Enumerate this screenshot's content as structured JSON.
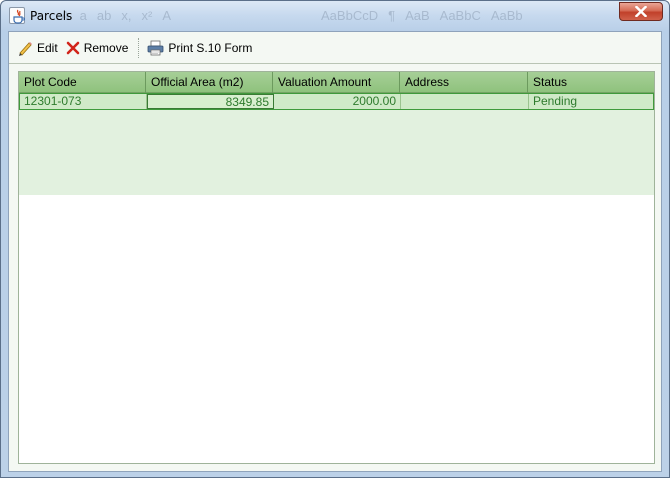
{
  "window": {
    "title": "Parcels",
    "ghost_items": [
      "A",
      "a",
      "ab",
      "x,",
      "x²",
      "A",
      "AaBbCcD",
      "¶",
      "AaB",
      "AaBbC",
      "AaBb"
    ]
  },
  "toolbar": {
    "edit_label": "Edit",
    "remove_label": "Remove",
    "print_label": "Print S.10 Form"
  },
  "table": {
    "columns": [
      "Plot Code",
      "Official Area (m2)",
      "Valuation Amount",
      "Address",
      "Status"
    ],
    "rows": [
      {
        "plot_code": "12301-073",
        "official_area": "8349.85",
        "valuation_amount": "2000.00",
        "address": "",
        "status": "Pending"
      }
    ]
  },
  "colors": {
    "header_green": "#8fc27d",
    "row_selected": "#d0eac8",
    "cell_text": "#2e7b2d",
    "close_red": "#c1402a"
  },
  "icons": [
    "java-app-icon",
    "pencil-icon",
    "red-x-icon",
    "printer-icon",
    "close-icon"
  ]
}
